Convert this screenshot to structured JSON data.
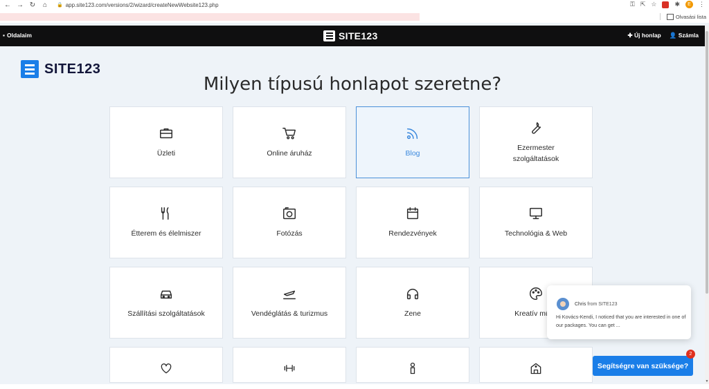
{
  "browser": {
    "url": "app.site123.com/versions/2/wizard/createNewWebsite123.php",
    "profile_initial": "E",
    "reading_list": "Olvasási lista"
  },
  "topbar": {
    "left_label": "Oldalaim",
    "brand": "SITE123",
    "new_site": "Új honlap",
    "account": "Számla"
  },
  "page": {
    "brand": "SITE123",
    "heading": "Milyen típusú honlapot szeretne?"
  },
  "categories": [
    {
      "label": "Üzleti",
      "icon": "briefcase-icon",
      "selected": false
    },
    {
      "label": "Online áruház",
      "icon": "cart-icon",
      "selected": false
    },
    {
      "label": "Blog",
      "icon": "rss-icon",
      "selected": true
    },
    {
      "label": "Ezermester szolgáltatások",
      "icon": "wrench-icon",
      "selected": false
    },
    {
      "label": "Étterem és élelmiszer",
      "icon": "cutlery-icon",
      "selected": false
    },
    {
      "label": "Fotózás",
      "icon": "camera-icon",
      "selected": false
    },
    {
      "label": "Rendezvények",
      "icon": "calendar-icon",
      "selected": false
    },
    {
      "label": "Technológia & Web",
      "icon": "monitor-icon",
      "selected": false
    },
    {
      "label": "Szállítási szolgáltatások",
      "icon": "car-icon",
      "selected": false
    },
    {
      "label": "Vendéglátás & turizmus",
      "icon": "plane-icon",
      "selected": false
    },
    {
      "label": "Zene",
      "icon": "headphones-icon",
      "selected": false
    },
    {
      "label": "Kreatív művé",
      "icon": "palette-icon",
      "selected": false
    },
    {
      "label": "",
      "icon": "heart-icon",
      "selected": false
    },
    {
      "label": "",
      "icon": "dumbbell-icon",
      "selected": false
    },
    {
      "label": "",
      "icon": "person-icon",
      "selected": false
    },
    {
      "label": "",
      "icon": "building-icon",
      "selected": false
    }
  ],
  "chat": {
    "sender": "Chris",
    "from": "from SITE123",
    "message": "Hi Kovács-Kendi, I noticed that you are interested in one of our packages. You can get ...",
    "help_button": "Segítségre van szüksége?",
    "badge_count": "2"
  }
}
